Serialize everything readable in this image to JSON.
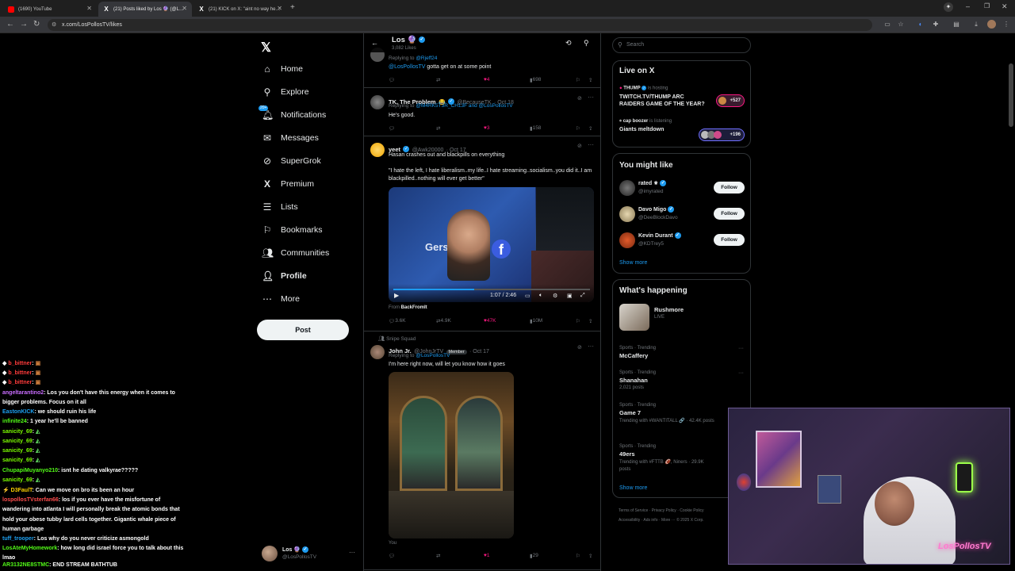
{
  "browser": {
    "tabs": [
      {
        "title": "(1690) YouTube",
        "favicon_color": "#ff0000"
      },
      {
        "title": "(21) Posts liked by Los 🔮 (@L…",
        "favicon_color": "#ffffff"
      },
      {
        "title": "(21) KICK on X: \"aint no way he…",
        "favicon_color": "#ffffff"
      }
    ],
    "url": "x.com/LosPollosTV/likes",
    "new_tab": "+"
  },
  "nav": {
    "items": [
      {
        "label": "Home",
        "icon": "home-icon"
      },
      {
        "label": "Explore",
        "icon": "search-icon"
      },
      {
        "label": "Notifications",
        "icon": "bell-icon",
        "badge": "20+"
      },
      {
        "label": "Messages",
        "icon": "mail-icon"
      },
      {
        "label": "SuperGrok",
        "icon": "grok-icon"
      },
      {
        "label": "Premium",
        "icon": "x-logo-icon"
      },
      {
        "label": "Lists",
        "icon": "list-icon"
      },
      {
        "label": "Bookmarks",
        "icon": "bookmark-icon"
      },
      {
        "label": "Communities",
        "icon": "people-icon"
      },
      {
        "label": "Profile",
        "icon": "person-icon"
      },
      {
        "label": "More",
        "icon": "more-circle-icon"
      }
    ],
    "post_label": "Post",
    "account": {
      "name": "Los 🔮",
      "handle": "@LosPollosTV"
    }
  },
  "header": {
    "name": "Los 🔮",
    "likes_count": "3,082 Likes"
  },
  "tweets": [
    {
      "replying_to": "@Rjeff24",
      "body_mention": "@LosPollosTV",
      "body": " gotta get on at some point",
      "stats": {
        "likes": "4",
        "views": "698"
      }
    },
    {
      "name": "TK, The Problem",
      "handle": "@BecauseTK",
      "date": "· Oct 18",
      "replying_prefix": "Replying to",
      "replying_to": "@M4RK5T3R_CH13F and @LosPollosTV",
      "body": "He's good.",
      "stats": {
        "likes": "3",
        "views": "158"
      }
    },
    {
      "name": "yeet",
      "handle": "@Awk20000",
      "date": "· Oct 17",
      "body": "Hasan crashes out and blackpills on everything",
      "quote": "\"I hate the left, I hate liberalism..my life..I hate streaming..socialism..you did it..I am blackpilled..nothing will ever get better\"",
      "video_time": "1:07 / 2:46",
      "from_label": "From",
      "from_source": "BackFromIt",
      "stats": {
        "replies": "3.6K",
        "reposts": "4.9K",
        "likes": "47K",
        "views": "10M"
      }
    },
    {
      "community": "Snipe Squad",
      "name": "John Jr.",
      "handle": "@JohnJrTV",
      "member_badge": "Member",
      "date": "· Oct 17",
      "replying_prefix": "Replying to",
      "replying_to": "@LosPollosTV",
      "body": "I'm here right now, will let you know how it goes",
      "image_caption": "You",
      "stats": {
        "likes": "1",
        "views": "29"
      }
    }
  ],
  "right": {
    "search_placeholder": "Search",
    "live": {
      "title": "Live on X",
      "items": [
        {
          "host": "THUMP",
          "status": "is hosting",
          "title": "TWITCH.TV/THUMP ARC RAIDERS GAME OF THE YEAR?",
          "count": "+527"
        },
        {
          "host": "cap boozer",
          "status": "is listening",
          "title": "Giants meltdown",
          "count": "+196"
        }
      ]
    },
    "you_might_like": {
      "title": "You might like",
      "items": [
        {
          "name": "rated ⚜",
          "handle": "@imyrated",
          "button": "Follow"
        },
        {
          "name": "Davo Migo",
          "handle": "@DeeBlockDavo",
          "button": "Follow"
        },
        {
          "name": "Kevin Durant",
          "handle": "@KDTrey5",
          "button": "Follow"
        }
      ],
      "show_more": "Show more"
    },
    "whats_happening": {
      "title": "What's happening",
      "featured": {
        "title": "Rushmore",
        "meta": "LIVE"
      },
      "trends": [
        {
          "meta": "Sports · Trending",
          "name": "McCaffery",
          "extra": ""
        },
        {
          "meta": "Sports · Trending",
          "name": "Shanahan",
          "extra": "2,021 posts"
        },
        {
          "meta": "Sports · Trending",
          "name": "Game 7",
          "extra": "Trending with #WANTITALL 🔗 · 42.4K posts"
        },
        {
          "meta": "Sports · Trending",
          "name": "49ers",
          "extra": "Trending with #FTTB 🏈, Niners · 29.9K posts"
        }
      ],
      "show_more": "Show more"
    },
    "footer": [
      "Terms of Service",
      "Privacy Policy",
      "Cookie Policy",
      "Accessibility",
      "Ads info",
      "More ···",
      "© 2025 X Corp."
    ]
  },
  "chat": [
    {
      "user": "b_bittner",
      "msg": "",
      "color": "#ff3b3b"
    },
    {
      "user": "b_bittner",
      "msg": "",
      "color": "#ff3b3b"
    },
    {
      "user": "b_bittner",
      "msg": "",
      "color": "#ff3b3b"
    },
    {
      "user": "angeltarantino2",
      "msg": "Los you don't have this energy when it comes to bigger problems. Focus on it all",
      "color": "#c96dff"
    },
    {
      "user": "EastonKICK",
      "msg": "we should ruin his life",
      "color": "#1da1f2"
    },
    {
      "user": "infinite24",
      "msg": "1 year he'll be banned",
      "color": "#53fc18"
    },
    {
      "user": "sanicity_69",
      "msg": "",
      "color": "#7cfc00"
    },
    {
      "user": "sanicity_69",
      "msg": "",
      "color": "#7cfc00"
    },
    {
      "user": "sanicity_69",
      "msg": "",
      "color": "#7cfc00"
    },
    {
      "user": "sanicity_69",
      "msg": "",
      "color": "#7cfc00"
    },
    {
      "user": "ChupapiMuyanyo210",
      "msg": "isnt he dating valkyrae?????",
      "color": "#53fc18"
    },
    {
      "user": "sanicity_69",
      "msg": "",
      "color": "#7cfc00"
    },
    {
      "user": "D3FaulT",
      "msg": "Can we move on bro its been an hour",
      "color": "#ffd400"
    },
    {
      "user": "lospollosTVsterfan66",
      "msg": "los if you ever have the misfortune of wandering into atlanta I will personally break the atomic bonds that hold your obese tubby lard cells together. Gigantic whale piece of human garbage",
      "color": "#ff4d4d"
    },
    {
      "user": "tuff_trooper",
      "msg": "Los why do you never criticize asmongold",
      "color": "#1da1f2"
    },
    {
      "user": "LosAteMyHomework",
      "msg": "how long did israel force you to talk about this lmao",
      "color": "#53fc18"
    },
    {
      "user": "AR3132NE8STMC",
      "msg": "END STREAM BATHTUB",
      "color": "#53fc18"
    }
  ]
}
